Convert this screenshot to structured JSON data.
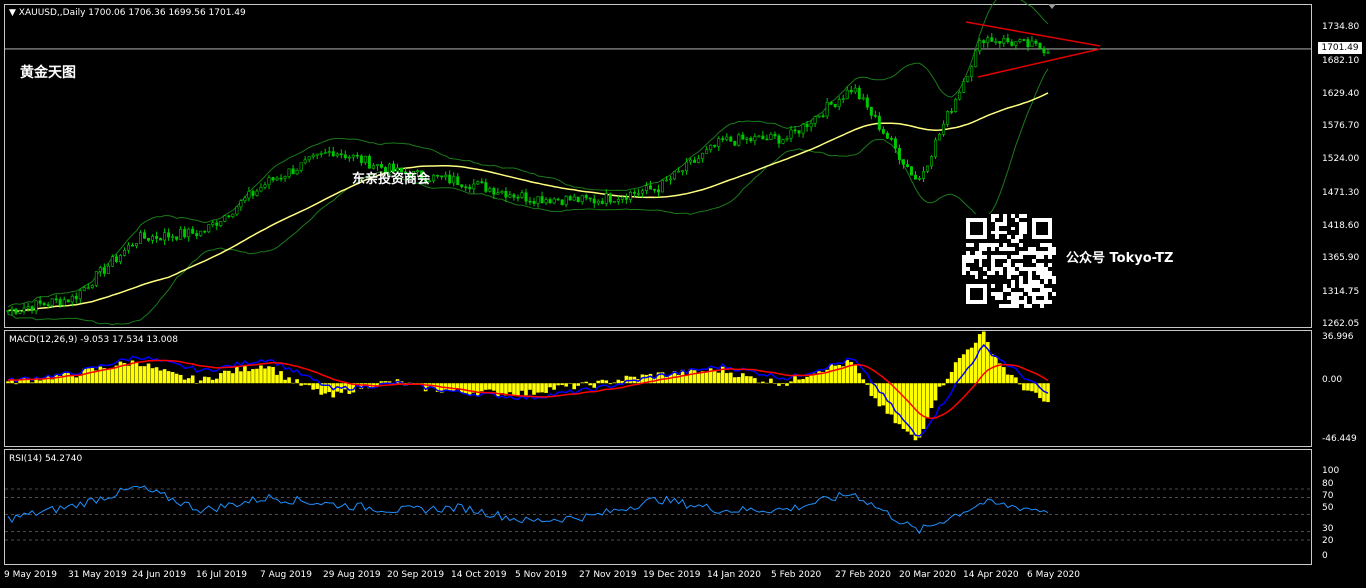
{
  "header": {
    "symbol_line": "XAUUSD,,Daily  1700.06 1706.36 1699.56 1701.49",
    "macd_label": "MACD(12,26,9) -9.053 17.534 13.008",
    "rsi_label": "RSI(14) 54.2740"
  },
  "watermarks": {
    "title": "黄金天图",
    "center": "东亲投资商会",
    "account": "公众号 Tokyo-TZ"
  },
  "price_axis": [
    "1734.80",
    "1682.10",
    "1629.40",
    "1576.70",
    "1524.00",
    "1471.30",
    "1418.60",
    "1365.90",
    "1314.75",
    "1262.05"
  ],
  "current_price": "1701.49",
  "macd_axis": [
    "36.996",
    "0.00",
    "-46.449"
  ],
  "rsi_axis": [
    "100",
    "80",
    "70",
    "50",
    "30",
    "20",
    "0"
  ],
  "dates": [
    "9 May 2019",
    "31 May 2019",
    "24 Jun 2019",
    "16 Jul 2019",
    "7 Aug 2019",
    "29 Aug 2019",
    "20 Sep 2019",
    "14 Oct 2019",
    "5 Nov 2019",
    "27 Nov 2019",
    "19 Dec 2019",
    "14 Jan 2020",
    "5 Feb 2020",
    "27 Feb 2020",
    "20 Mar 2020",
    "14 Apr 2020",
    "6 May 2020"
  ],
  "colors": {
    "bull": "#00c800",
    "bear": "#00c800",
    "ma": "#ffff80",
    "band": "#1a7a1a",
    "trend": "#e00000",
    "macd_hist": "#ffff00",
    "macd_line": "#0000ff",
    "signal_line": "#ff0000",
    "rsi": "#1e90ff"
  },
  "chart_data": [
    {
      "type": "candlestick",
      "title": "XAUUSD,,Daily",
      "ylim": [
        1262.05,
        1734.8
      ],
      "x": [
        "9 May 2019",
        "31 May 2019",
        "24 Jun 2019",
        "16 Jul 2019",
        "7 Aug 2019",
        "29 Aug 2019",
        "20 Sep 2019",
        "14 Oct 2019",
        "5 Nov 2019",
        "27 Nov 2019",
        "19 Dec 2019",
        "14 Jan 2020",
        "5 Feb 2020",
        "27 Feb 2020",
        "20 Mar 2020",
        "14 Apr 2020",
        "6 May 2020"
      ],
      "close_approx": [
        1285,
        1305,
        1400,
        1410,
        1490,
        1540,
        1505,
        1490,
        1465,
        1460,
        1480,
        1555,
        1560,
        1640,
        1490,
        1720,
        1701.49
      ],
      "last": {
        "open": 1700.06,
        "high": 1706.36,
        "low": 1699.56,
        "close": 1701.49
      }
    },
    {
      "type": "area",
      "title": "MACD(12,26,9)",
      "ylim": [
        -46.449,
        36.996
      ],
      "values_approx": [
        2,
        8,
        22,
        10,
        20,
        -5,
        0,
        -8,
        -12,
        -5,
        6,
        14,
        4,
        20,
        -45,
        30,
        -9.053
      ],
      "macd": -9.053,
      "signal": 17.534,
      "third": 13.008
    },
    {
      "type": "line",
      "title": "RSI(14)",
      "ylim": [
        0,
        100
      ],
      "values_approx": [
        45,
        60,
        82,
        55,
        70,
        62,
        55,
        58,
        42,
        48,
        68,
        55,
        56,
        75,
        30,
        64,
        54.274
      ],
      "last": 54.274
    }
  ]
}
